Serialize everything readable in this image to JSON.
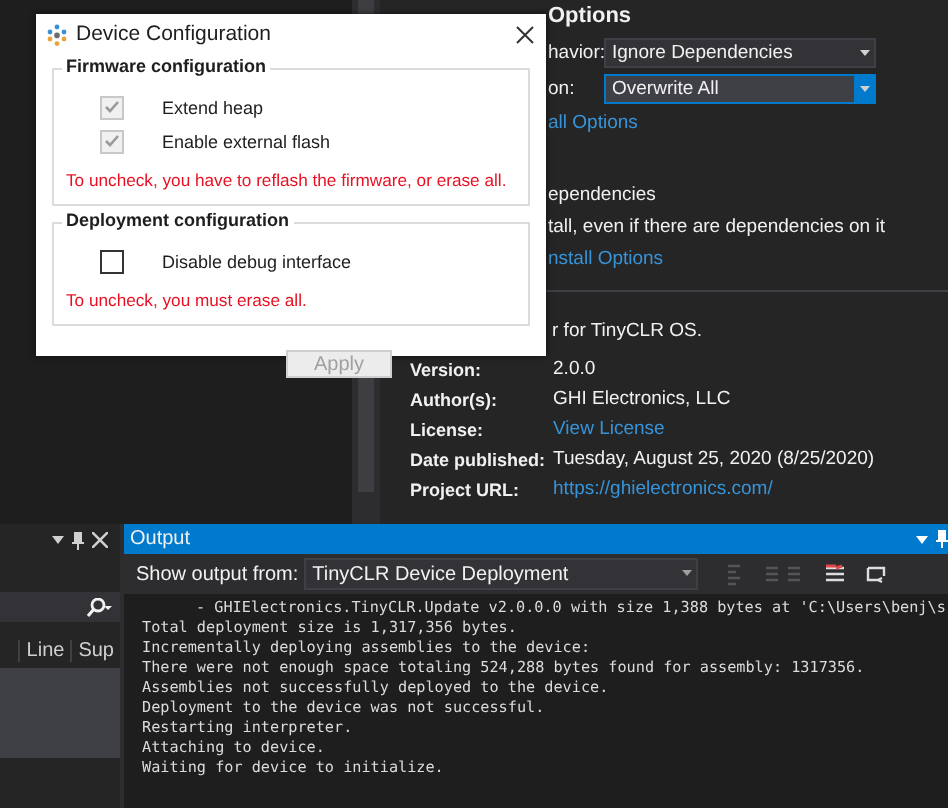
{
  "dialog": {
    "title": "Device Configuration",
    "groups": [
      {
        "title": "Firmware configuration",
        "options": [
          {
            "label": "Extend heap",
            "checked": true,
            "disabled": true
          },
          {
            "label": "Enable external flash",
            "checked": true,
            "disabled": true
          }
        ],
        "note": "To uncheck, you have to reflash the firmware, or erase all."
      },
      {
        "title": "Deployment configuration",
        "options": [
          {
            "label": "Disable debug interface",
            "checked": false,
            "disabled": false
          }
        ],
        "note": "To uncheck, you must erase all."
      }
    ],
    "apply": {
      "label": "Apply",
      "disabled": true
    }
  },
  "package_options": {
    "heading": "Options",
    "fields": [
      {
        "label": "havior:",
        "value": "Ignore Dependencies",
        "focused": false
      },
      {
        "label": "on:",
        "value": "Overwrite All",
        "focused": true
      }
    ],
    "lines": [
      {
        "kind": "link",
        "text": "all Options"
      },
      {
        "kind": "text",
        "text": "ependencies"
      },
      {
        "kind": "text",
        "text": "tall, even if there are dependencies on it"
      },
      {
        "kind": "link",
        "text": "nstall Options"
      }
    ]
  },
  "description": "r for TinyCLR OS.",
  "details": [
    {
      "label": "Version:",
      "value": "2.0.0",
      "kind": "text"
    },
    {
      "label": "Author(s):",
      "value": "GHI Electronics, LLC",
      "kind": "text"
    },
    {
      "label": "License:",
      "value": "View License",
      "kind": "link"
    },
    {
      "label": "Date published:",
      "value": "Tuesday, August 25, 2020 (8/25/2020)",
      "kind": "text"
    },
    {
      "label": "Project URL:",
      "value": "https://ghielectronics.com/",
      "kind": "link"
    }
  ],
  "error_list": {
    "columns": [
      "Line",
      "Sup"
    ]
  },
  "output": {
    "title": "Output",
    "source_label": "Show output from:",
    "source": "TinyCLR Device Deployment",
    "lines": [
      {
        "text": "- GHIElectronics.TinyCLR.Update v2.0.0.0 with size 1,388 bytes at 'C:\\Users\\benj\\s",
        "indent": true
      },
      {
        "text": "Total deployment size is 1,317,356 bytes.",
        "indent": false
      },
      {
        "text": "Incrementally deploying assemblies to the device:",
        "indent": false
      },
      {
        "text": "There were not enough space totaling 524,288 bytes found for assembly: 1317356.",
        "indent": false
      },
      {
        "text": "Assemblies not successfully deployed to the device.",
        "indent": false
      },
      {
        "text": "Deployment to the device was not successful.",
        "indent": false
      },
      {
        "text": "Restarting interpreter.",
        "indent": false
      },
      {
        "text": "Attaching to device.",
        "indent": false
      },
      {
        "text": "Waiting for device to initialize.",
        "indent": false
      }
    ]
  }
}
